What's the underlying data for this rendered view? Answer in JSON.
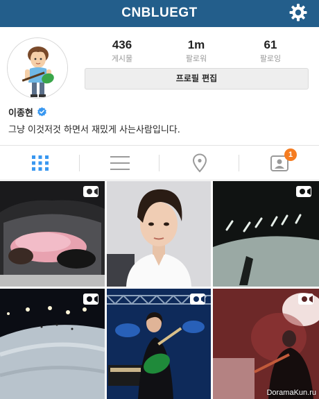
{
  "header": {
    "title": "CNBLUEGT",
    "settings_icon": "gear-icon"
  },
  "profile": {
    "stats": [
      {
        "value": "436",
        "label": "게시물"
      },
      {
        "value": "1m",
        "label": "팔로워"
      },
      {
        "value": "61",
        "label": "팔로잉"
      }
    ],
    "edit_button_label": "프로필 편집",
    "name": "이종현",
    "verified": true,
    "bio": "그냥 이것저것 하면서 재밌게 사는사람입니다."
  },
  "tabs": {
    "items": [
      {
        "icon": "grid-icon",
        "active": true
      },
      {
        "icon": "list-icon",
        "active": false
      },
      {
        "icon": "location-pin-icon",
        "active": false
      },
      {
        "icon": "tagged-person-icon",
        "active": false
      }
    ],
    "tagged_badge_count": "1"
  },
  "colors": {
    "header_bg": "#235e8b",
    "accent_blue": "#3897f0",
    "badge_orange": "#f57c20"
  },
  "watermark": "DoramaKun.ru"
}
